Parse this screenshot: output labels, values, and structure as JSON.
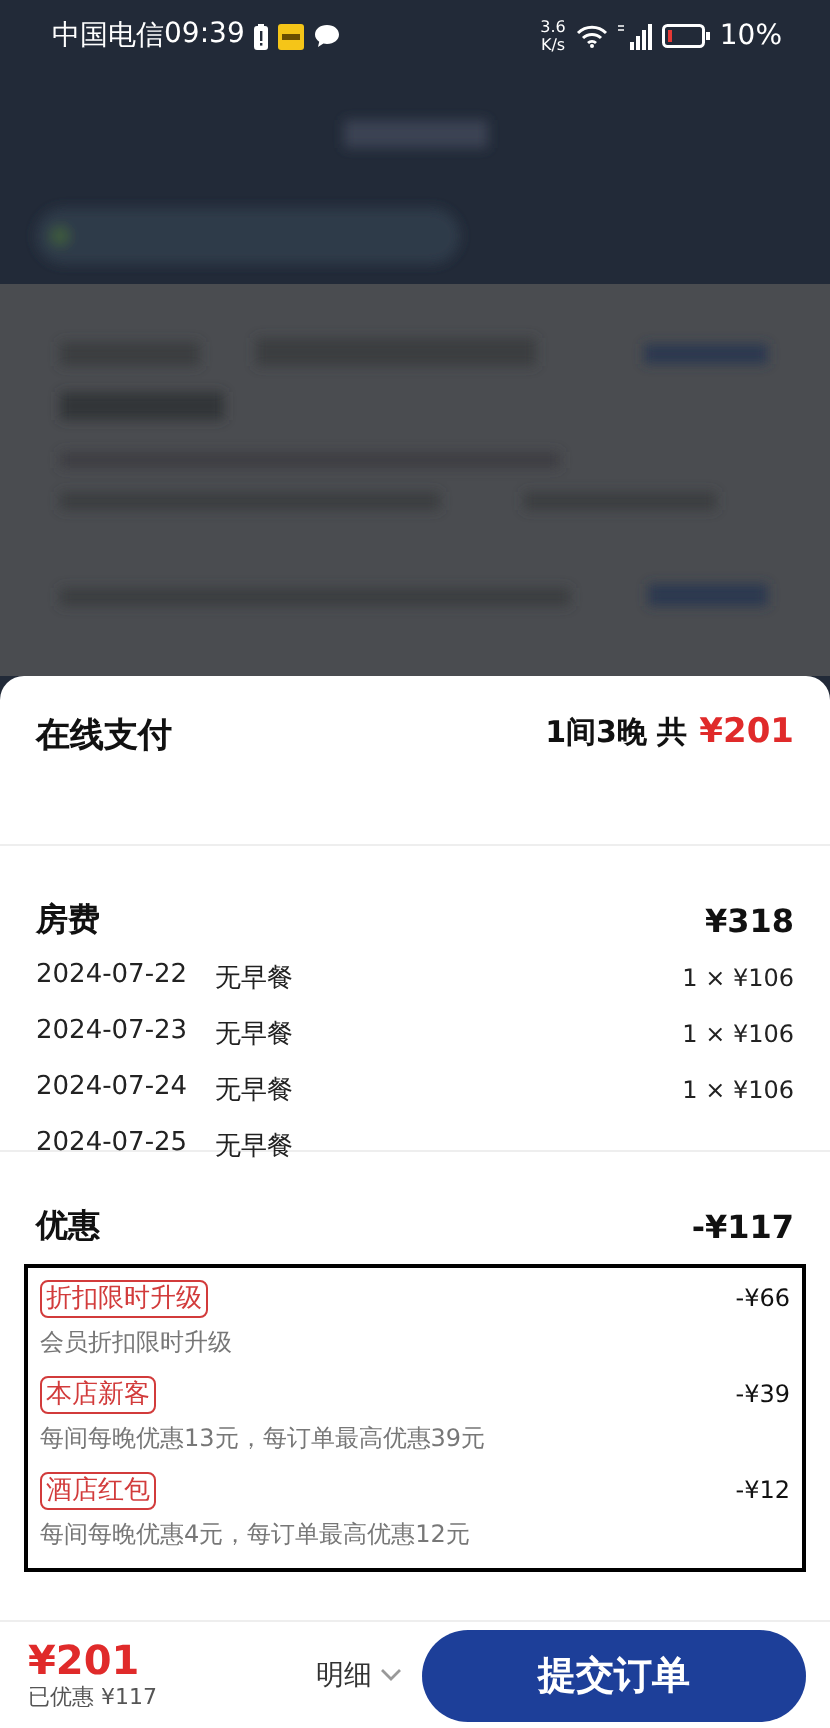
{
  "status_bar": {
    "carrier": "中国电信",
    "time": "09:39",
    "speed_value": "3.6",
    "speed_unit": "K/s",
    "battery": "10%"
  },
  "sheet": {
    "title": "在线支付",
    "summary": "1间3晚 共",
    "total": "¥201"
  },
  "room_fee": {
    "label": "房费",
    "amount": "¥318",
    "nights": [
      {
        "date": "2024-07-22",
        "meal": "无早餐",
        "price": "1 × ¥106"
      },
      {
        "date": "2024-07-23",
        "meal": "无早餐",
        "price": "1 × ¥106"
      },
      {
        "date": "2024-07-24",
        "meal": "无早餐",
        "price": "1 × ¥106"
      },
      {
        "date": "2024-07-25",
        "meal": "无早餐"
      }
    ]
  },
  "discounts": {
    "label": "优惠",
    "amount": "-¥117",
    "items": [
      {
        "tag": "折扣限时升级",
        "amount": "-¥66",
        "description": "会员折扣限时升级"
      },
      {
        "tag": "本店新客",
        "amount": "-¥39",
        "description": "每间每晚优惠13元，每订单最高优惠39元"
      },
      {
        "tag": "酒店红包",
        "amount": "-¥12",
        "description": "每间每晚优惠4元，每订单最高优惠12元"
      }
    ]
  },
  "footer": {
    "total": "¥201",
    "saved": "已优惠 ¥117",
    "detail": "明细",
    "submit": "提交订单"
  }
}
